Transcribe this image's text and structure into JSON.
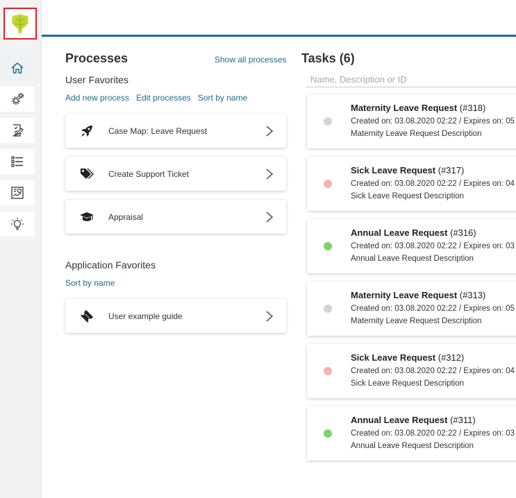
{
  "colors": {
    "accent": "#1f6b8c",
    "logo_frame": "#e01f26",
    "status_gray": "#d4d4d4",
    "status_red": "#f2b4b4",
    "status_green": "#7dd36a"
  },
  "sidebar": {
    "items": [
      {
        "icon": "home-icon",
        "active": true
      },
      {
        "icon": "settings-gears-icon",
        "active": false
      },
      {
        "icon": "task-checklist-icon",
        "active": false
      },
      {
        "icon": "list-icon",
        "active": false
      },
      {
        "icon": "dashboard-report-icon",
        "active": false
      },
      {
        "icon": "lightbulb-icon",
        "active": false
      }
    ]
  },
  "processes": {
    "title": "Processes",
    "show_all": "Show all processes",
    "user_favorites": {
      "heading": "User Favorites",
      "actions": [
        "Add new process",
        "Edit processes",
        "Sort by name"
      ],
      "items": [
        {
          "label": "Case Map: Leave Request",
          "icon": "rocket-icon"
        },
        {
          "label": "Create Support Ticket",
          "icon": "tags-icon"
        },
        {
          "label": "Appraisal",
          "icon": "graduation-cap-icon"
        }
      ]
    },
    "application_favorites": {
      "heading": "Application Favorites",
      "actions": [
        "Sort by name"
      ],
      "items": [
        {
          "label": "User example guide",
          "icon": "ticket-icon"
        }
      ]
    }
  },
  "tasks": {
    "title": "Tasks (6)",
    "search_placeholder": "Name, Description or ID",
    "items": [
      {
        "name": "Maternity Leave Request",
        "id": "(#318)",
        "meta": "Created on: 03.08.2020 02:22 / Expires on: 05",
        "desc": "Maternity Leave Request Description",
        "status": "gray"
      },
      {
        "name": "Sick Leave Request",
        "id": "(#317)",
        "meta": "Created on: 03.08.2020 02:22 / Expires on: 04",
        "desc": "Sick Leave Request Description",
        "status": "red"
      },
      {
        "name": "Annual Leave Request",
        "id": "(#316)",
        "meta": "Created on: 03.08.2020 02:22 / Expires on: 03",
        "desc": "Annual Leave Request Description",
        "status": "green"
      },
      {
        "name": "Maternity Leave Request",
        "id": "(#313)",
        "meta": "Created on: 03.08.2020 02:22 / Expires on: 05",
        "desc": "Maternity Leave Request Description",
        "status": "gray"
      },
      {
        "name": "Sick Leave Request",
        "id": "(#312)",
        "meta": "Created on: 03.08.2020 02:22 / Expires on: 04",
        "desc": "Sick Leave Request Description",
        "status": "red"
      },
      {
        "name": "Annual Leave Request",
        "id": "(#311)",
        "meta": "Created on: 03.08.2020 02:22 / Expires on: 03",
        "desc": "Annual Leave Request Description",
        "status": "green"
      }
    ]
  }
}
